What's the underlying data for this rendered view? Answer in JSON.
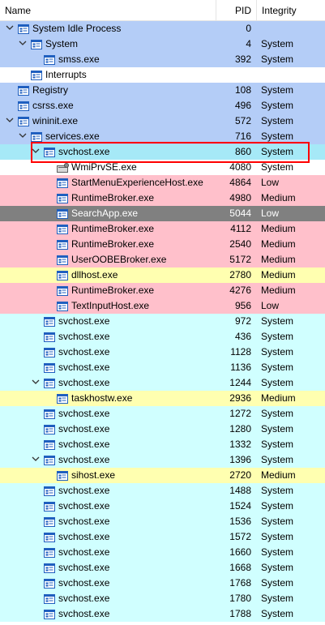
{
  "columns": {
    "name": "Name",
    "pid": "PID",
    "integrity": "Integrity"
  },
  "colors": {
    "blue": "#b4cdf7",
    "pink": "#ffc0cb",
    "cyan": "#d0ffff",
    "yellow": "#ffffb0",
    "gray": "#808080",
    "selected": "#a6e9f7",
    "white": "#ffffff",
    "highlight_border": "#ff0000"
  },
  "rows": [
    {
      "indent": 0,
      "expander": "v",
      "name": "System Idle Process",
      "pid": "0",
      "integrity": "",
      "bg": "blue"
    },
    {
      "indent": 1,
      "expander": "v",
      "name": "System",
      "pid": "4",
      "integrity": "System",
      "bg": "blue"
    },
    {
      "indent": 2,
      "expander": "",
      "name": "smss.exe",
      "pid": "392",
      "integrity": "System",
      "bg": "blue"
    },
    {
      "indent": 1,
      "expander": "",
      "name": "Interrupts",
      "pid": "",
      "integrity": "",
      "bg": "white"
    },
    {
      "indent": 0,
      "expander": "",
      "name": "Registry",
      "pid": "108",
      "integrity": "System",
      "bg": "blue"
    },
    {
      "indent": 0,
      "expander": "",
      "name": "csrss.exe",
      "pid": "496",
      "integrity": "System",
      "bg": "blue"
    },
    {
      "indent": 0,
      "expander": "v",
      "name": "wininit.exe",
      "pid": "572",
      "integrity": "System",
      "bg": "blue"
    },
    {
      "indent": 1,
      "expander": "v",
      "name": "services.exe",
      "pid": "716",
      "integrity": "System",
      "bg": "blue"
    },
    {
      "indent": 2,
      "expander": "v",
      "name": "svchost.exe",
      "pid": "860",
      "integrity": "System",
      "bg": "selected",
      "highlight": true
    },
    {
      "indent": 3,
      "expander": "",
      "name": "WmiPrvSE.exe",
      "pid": "4080",
      "integrity": "System",
      "bg": "white",
      "icon": "gear"
    },
    {
      "indent": 3,
      "expander": "",
      "name": "StartMenuExperienceHost.exe",
      "pid": "4864",
      "integrity": "Low",
      "bg": "pink"
    },
    {
      "indent": 3,
      "expander": "",
      "name": "RuntimeBroker.exe",
      "pid": "4980",
      "integrity": "Medium",
      "bg": "pink"
    },
    {
      "indent": 3,
      "expander": "",
      "name": "SearchApp.exe",
      "pid": "5044",
      "integrity": "Low",
      "bg": "gray"
    },
    {
      "indent": 3,
      "expander": "",
      "name": "RuntimeBroker.exe",
      "pid": "4112",
      "integrity": "Medium",
      "bg": "pink"
    },
    {
      "indent": 3,
      "expander": "",
      "name": "RuntimeBroker.exe",
      "pid": "2540",
      "integrity": "Medium",
      "bg": "pink"
    },
    {
      "indent": 3,
      "expander": "",
      "name": "UserOOBEBroker.exe",
      "pid": "5172",
      "integrity": "Medium",
      "bg": "pink"
    },
    {
      "indent": 3,
      "expander": "",
      "name": "dllhost.exe",
      "pid": "2780",
      "integrity": "Medium",
      "bg": "yellow"
    },
    {
      "indent": 3,
      "expander": "",
      "name": "RuntimeBroker.exe",
      "pid": "4276",
      "integrity": "Medium",
      "bg": "pink"
    },
    {
      "indent": 3,
      "expander": "",
      "name": "TextInputHost.exe",
      "pid": "956",
      "integrity": "Low",
      "bg": "pink"
    },
    {
      "indent": 2,
      "expander": "",
      "name": "svchost.exe",
      "pid": "972",
      "integrity": "System",
      "bg": "cyan"
    },
    {
      "indent": 2,
      "expander": "",
      "name": "svchost.exe",
      "pid": "436",
      "integrity": "System",
      "bg": "cyan"
    },
    {
      "indent": 2,
      "expander": "",
      "name": "svchost.exe",
      "pid": "1128",
      "integrity": "System",
      "bg": "cyan"
    },
    {
      "indent": 2,
      "expander": "",
      "name": "svchost.exe",
      "pid": "1136",
      "integrity": "System",
      "bg": "cyan"
    },
    {
      "indent": 2,
      "expander": "v",
      "name": "svchost.exe",
      "pid": "1244",
      "integrity": "System",
      "bg": "cyan"
    },
    {
      "indent": 3,
      "expander": "",
      "name": "taskhostw.exe",
      "pid": "2936",
      "integrity": "Medium",
      "bg": "yellow"
    },
    {
      "indent": 2,
      "expander": "",
      "name": "svchost.exe",
      "pid": "1272",
      "integrity": "System",
      "bg": "cyan"
    },
    {
      "indent": 2,
      "expander": "",
      "name": "svchost.exe",
      "pid": "1280",
      "integrity": "System",
      "bg": "cyan"
    },
    {
      "indent": 2,
      "expander": "",
      "name": "svchost.exe",
      "pid": "1332",
      "integrity": "System",
      "bg": "cyan"
    },
    {
      "indent": 2,
      "expander": "v",
      "name": "svchost.exe",
      "pid": "1396",
      "integrity": "System",
      "bg": "cyan"
    },
    {
      "indent": 3,
      "expander": "",
      "name": "sihost.exe",
      "pid": "2720",
      "integrity": "Medium",
      "bg": "yellow"
    },
    {
      "indent": 2,
      "expander": "",
      "name": "svchost.exe",
      "pid": "1488",
      "integrity": "System",
      "bg": "cyan"
    },
    {
      "indent": 2,
      "expander": "",
      "name": "svchost.exe",
      "pid": "1524",
      "integrity": "System",
      "bg": "cyan"
    },
    {
      "indent": 2,
      "expander": "",
      "name": "svchost.exe",
      "pid": "1536",
      "integrity": "System",
      "bg": "cyan"
    },
    {
      "indent": 2,
      "expander": "",
      "name": "svchost.exe",
      "pid": "1572",
      "integrity": "System",
      "bg": "cyan"
    },
    {
      "indent": 2,
      "expander": "",
      "name": "svchost.exe",
      "pid": "1660",
      "integrity": "System",
      "bg": "cyan"
    },
    {
      "indent": 2,
      "expander": "",
      "name": "svchost.exe",
      "pid": "1668",
      "integrity": "System",
      "bg": "cyan"
    },
    {
      "indent": 2,
      "expander": "",
      "name": "svchost.exe",
      "pid": "1768",
      "integrity": "System",
      "bg": "cyan"
    },
    {
      "indent": 2,
      "expander": "",
      "name": "svchost.exe",
      "pid": "1780",
      "integrity": "System",
      "bg": "cyan"
    },
    {
      "indent": 2,
      "expander": "",
      "name": "svchost.exe",
      "pid": "1788",
      "integrity": "System",
      "bg": "cyan"
    }
  ]
}
